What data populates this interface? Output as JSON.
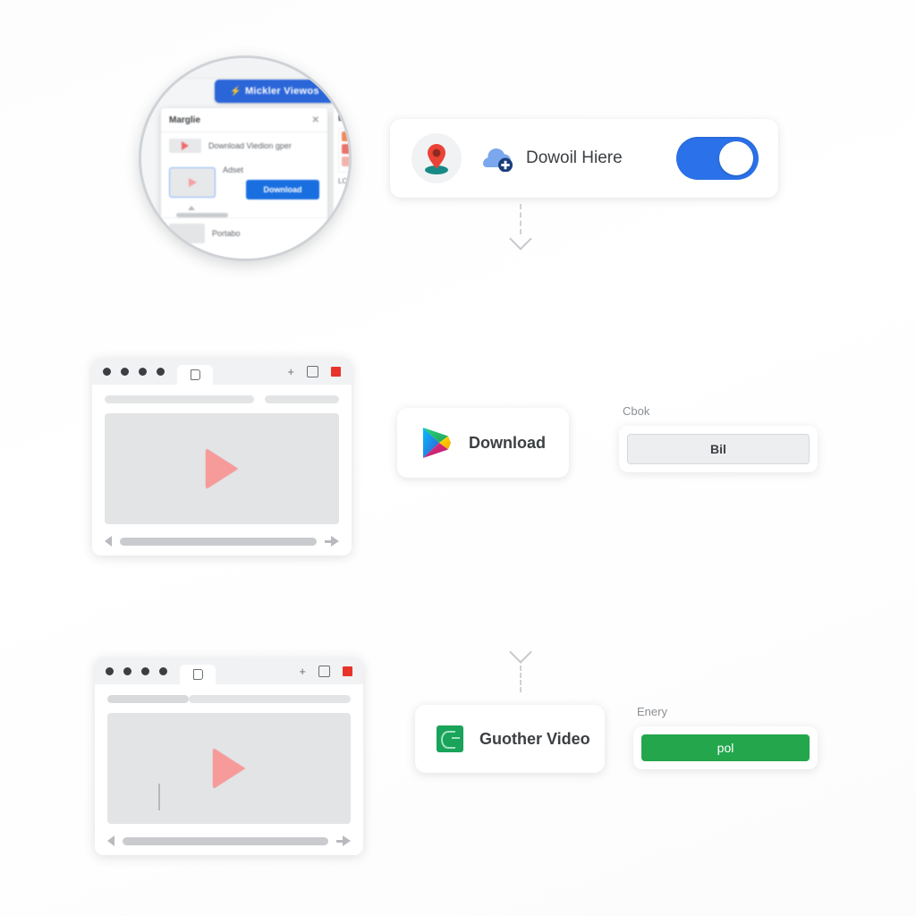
{
  "magnifier": {
    "promo_button": {
      "label": "Mickler Viewos",
      "icon": "bolt-icon"
    },
    "dialog": {
      "title": "Marglie",
      "close_icon": "close-icon",
      "row_label": "Download Viedion gper",
      "option_label": "Adset",
      "primary_button": "Download",
      "footer_label": "Portabo"
    },
    "side_panel": {
      "title": "De",
      "text": "LC"
    }
  },
  "toggle_card": {
    "pin_icon": "map-pin-icon",
    "cloud_icon": "cloud-plus-icon",
    "label": "Dowoil Hiere",
    "toggle_state": "on"
  },
  "browser_1": {
    "tab_glyph": "page-icon",
    "plus": "+",
    "dot_count": 4
  },
  "browser_2": {
    "tab_glyph": "page-icon",
    "plus": "+",
    "dot_count": 4
  },
  "download_card": {
    "icon": "google-play-icon",
    "label": "Download"
  },
  "video_card": {
    "icon": "green-video-icon",
    "label": "Guother Video"
  },
  "gray_field": {
    "caption": "Cbok",
    "button_label": "Bil"
  },
  "green_field": {
    "caption": "Enery",
    "button_label": "pol"
  },
  "colors": {
    "blue_accent": "#2b72ea",
    "green_accent": "#24a64d",
    "red_close": "#e8332a",
    "play_triangle": "#f79a9a",
    "pin_red": "#ea4335",
    "pin_teal": "#188a86"
  }
}
